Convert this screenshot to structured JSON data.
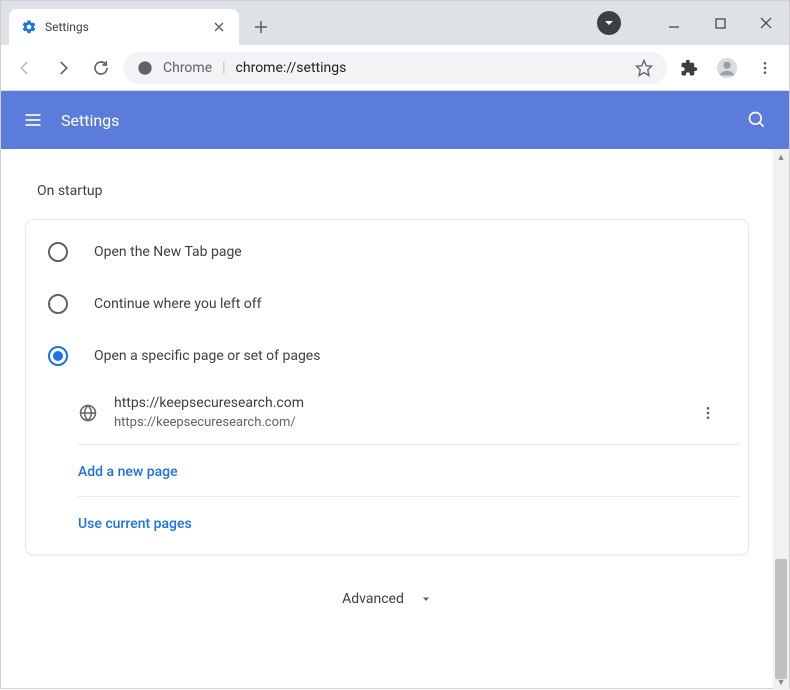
{
  "tab": {
    "title": "Settings"
  },
  "omnibox": {
    "chrome_label": "Chrome",
    "divider": "|",
    "path": "chrome://settings"
  },
  "appbar": {
    "title": "Settings"
  },
  "section": {
    "heading": "On startup"
  },
  "radios": {
    "new_tab": "Open the New Tab page",
    "continue": "Continue where you left off",
    "specific": "Open a specific page or set of pages"
  },
  "startup_page": {
    "title": "https://keepsecuresearch.com",
    "url": "https://keepsecuresearch.com/"
  },
  "links": {
    "add_page": "Add a new page",
    "use_current": "Use current pages"
  },
  "advanced": {
    "label": "Advanced"
  }
}
